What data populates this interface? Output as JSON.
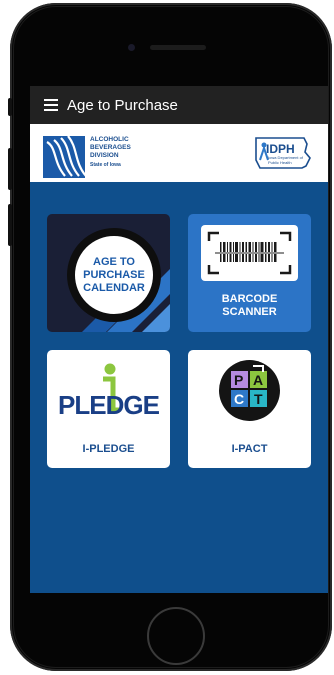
{
  "app": {
    "title": "Age to Purchase"
  },
  "logos": {
    "abd": {
      "line1": "ALCOHOLIC",
      "line2": "BEVERAGES",
      "line3": "DIVISION",
      "line4": "State of Iowa"
    },
    "idph": {
      "name": "IDPH",
      "subtitle": "Iowa Department of Public Health"
    }
  },
  "tiles": [
    {
      "label_lines": [
        "AGE TO",
        "PURCHASE",
        "CALENDAR"
      ],
      "icon": "calendar-magnifier-icon"
    },
    {
      "label_lines": [
        "BARCODE",
        "SCANNER"
      ],
      "icon": "barcode-icon"
    },
    {
      "label": "I-PLEDGE",
      "logo_text": "PLEDGE",
      "icon": "i-pledge-logo"
    },
    {
      "label": "I-PACT",
      "logo_letters": [
        "P",
        "A",
        "C",
        "T"
      ],
      "icon": "i-pact-logo"
    }
  ],
  "colors": {
    "screen_bg": "#0f4f8c",
    "appbar_bg": "#222222",
    "tile_blue": "#2c74c6",
    "brand_blue": "#1b5aa8"
  }
}
